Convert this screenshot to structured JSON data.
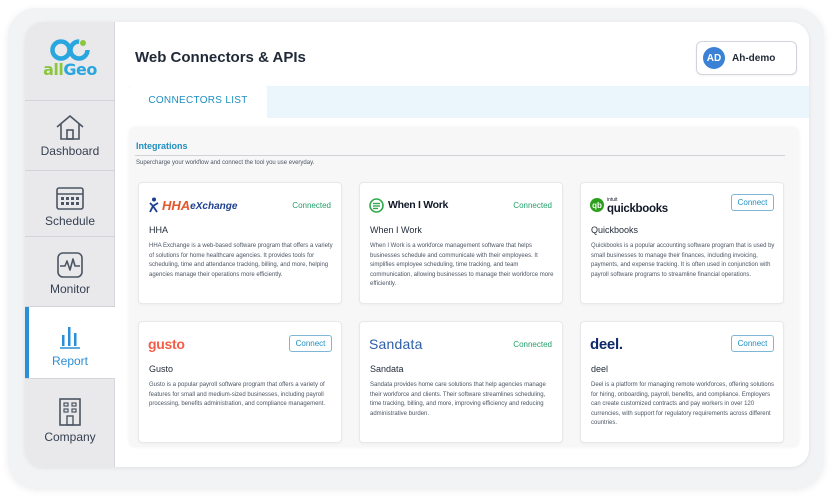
{
  "logo": {
    "text_a": "all",
    "text_b": "Geo"
  },
  "sidebar": {
    "items": [
      {
        "label": "Dashboard",
        "icon": "home-icon"
      },
      {
        "label": "Schedule",
        "icon": "calendar-icon"
      },
      {
        "label": "Monitor",
        "icon": "monitor-icon"
      },
      {
        "label": "Report",
        "icon": "bar-chart-icon",
        "active": true
      },
      {
        "label": "Company",
        "icon": "building-icon"
      }
    ]
  },
  "header": {
    "title": "Web Connectors & APIs",
    "user": {
      "initials": "AD",
      "name": "Ah-demo"
    }
  },
  "tabs": [
    {
      "label": "CONNECTORS LIST",
      "active": true
    }
  ],
  "section": {
    "title": "Integrations",
    "subtitle": "Supercharge your workflow and connect the tool you use everyday."
  },
  "colors": {
    "accent": "#2a8fd6",
    "connected": "#22a06b",
    "logo_green": "#8cc63f",
    "logo_blue": "#2aa6df"
  },
  "cards": [
    {
      "brand": "HHAeXchange",
      "brand_a": "HHA",
      "brand_b": "eXchange",
      "status": "Connected",
      "name": "HHA",
      "description": "HHA Exchange is a web-based software program that offers a variety of solutions for home healthcare agencies. It provides tools for scheduling, time and attendance tracking, billing, and more, helping agencies manage their operations more efficiently."
    },
    {
      "brand": "When I Work",
      "status": "Connected",
      "name": "When I Work",
      "description": "When I Work is a workforce management software that helps businesses schedule and communicate with their employees. It simplifies employee scheduling, time tracking, and team communication, allowing businesses to manage their workforce more efficiently."
    },
    {
      "brand": "quickbooks",
      "brand_small": "intuit",
      "button": "Connect",
      "name": "Quickbooks",
      "description": "Quickbooks is a popular accounting software program that is used by small businesses to manage their finances, including invoicing, payments, and expense tracking. It is often used in conjunction with payroll software programs to streamline financial operations."
    },
    {
      "brand": "gusto",
      "button": "Connect",
      "name": "Gusto",
      "description": "Gusto is a popular payroll software program that offers a variety of features for small and medium-sized businesses, including payroll processing, benefits administration, and compliance management."
    },
    {
      "brand": "Sandata",
      "status": "Connected",
      "name": "Sandata",
      "description": "Sandata provides home care solutions that help agencies manage their workforce and clients. Their software streamlines scheduling, time tracking, billing, and more, improving efficiency and reducing administrative burden."
    },
    {
      "brand": "deel.",
      "button": "Connect",
      "name": "deel",
      "description": "Deel is a platform for managing remote workforces, offering solutions for hiring, onboarding, payroll, benefits, and compliance. Employers can create customized contracts and pay workers in over 120 currencies, with support for regulatory requirements across different countries."
    }
  ]
}
